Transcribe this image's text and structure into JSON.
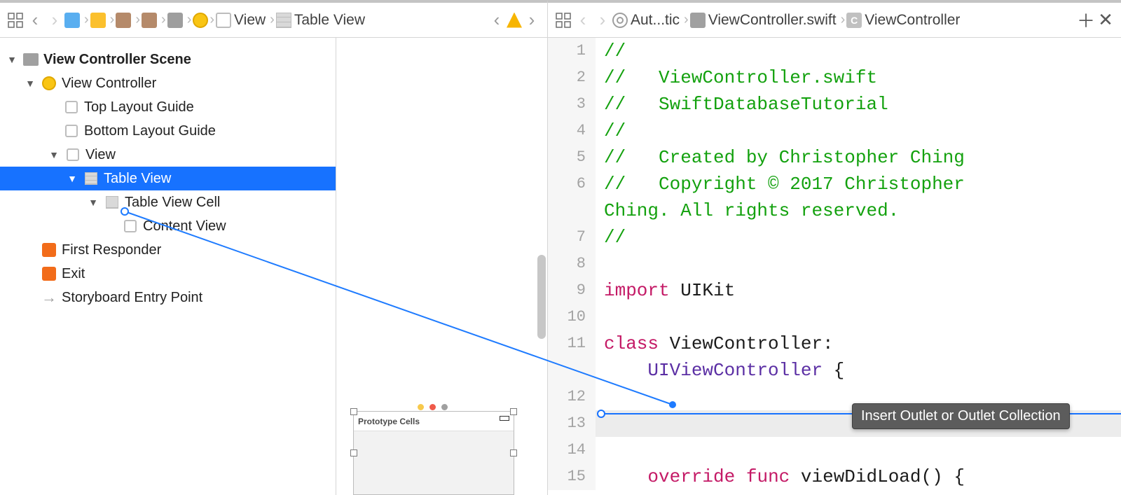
{
  "left_bar": {
    "crumb_view": "View",
    "crumb_tableview": "Table View"
  },
  "right_bar": {
    "crumb_aut": "Aut...tic",
    "crumb_file": "ViewController.swift",
    "crumb_class": "ViewController"
  },
  "outline": {
    "scene": "View Controller Scene",
    "vc": "View Controller",
    "top_guide": "Top Layout Guide",
    "bottom_guide": "Bottom Layout Guide",
    "view": "View",
    "table_view": "Table View",
    "table_view_cell": "Table View Cell",
    "content_view": "Content View",
    "first_responder": "First Responder",
    "exit": "Exit",
    "entry_point": "Storyboard Entry Point"
  },
  "canvas": {
    "prototype_label": "Prototype Cells"
  },
  "code": {
    "lines": [
      {
        "n": "1",
        "segs": [
          {
            "t": "//",
            "c": "c-comment"
          }
        ]
      },
      {
        "n": "2",
        "segs": [
          {
            "t": "//   ViewController.swift",
            "c": "c-comment"
          }
        ]
      },
      {
        "n": "3",
        "segs": [
          {
            "t": "//   SwiftDatabaseTutorial",
            "c": "c-comment"
          }
        ]
      },
      {
        "n": "4",
        "segs": [
          {
            "t": "//",
            "c": "c-comment"
          }
        ]
      },
      {
        "n": "5",
        "segs": [
          {
            "t": "//   Created by Christopher Ching",
            "c": "c-comment"
          }
        ]
      },
      {
        "n": "6",
        "segs": [
          {
            "t": "//   Copyright © 2017 Christopher Ching. All rights reserved.",
            "c": "c-comment"
          }
        ]
      },
      {
        "n": "7",
        "segs": [
          {
            "t": "//",
            "c": "c-comment"
          }
        ]
      },
      {
        "n": "8",
        "segs": [
          {
            "t": "",
            "c": "c-plain"
          }
        ]
      },
      {
        "n": "9",
        "segs": [
          {
            "t": "import",
            "c": "c-keyword"
          },
          {
            "t": " UIKit",
            "c": "c-plain"
          }
        ]
      },
      {
        "n": "10",
        "segs": [
          {
            "t": "",
            "c": "c-plain"
          }
        ]
      },
      {
        "n": "11",
        "segs": [
          {
            "t": "class",
            "c": "c-keyword"
          },
          {
            "t": " ViewController: ",
            "c": "c-plain"
          },
          {
            "t": "UIViewController",
            "c": "c-type"
          },
          {
            "t": " {",
            "c": "c-plain"
          }
        ]
      },
      {
        "n": "12",
        "segs": [
          {
            "t": "",
            "c": "c-plain"
          }
        ]
      },
      {
        "n": "13",
        "segs": [
          {
            "t": "",
            "c": "c-plain"
          }
        ],
        "current": true
      },
      {
        "n": "14",
        "segs": [
          {
            "t": "",
            "c": "c-plain"
          }
        ]
      },
      {
        "n": "15",
        "segs": [
          {
            "t": "    ",
            "c": "c-plain"
          },
          {
            "t": "override",
            "c": "c-keyword"
          },
          {
            "t": " ",
            "c": "c-plain"
          },
          {
            "t": "func",
            "c": "c-keyword"
          },
          {
            "t": " viewDidLoad() {",
            "c": "c-plain"
          }
        ]
      }
    ]
  },
  "tooltip": "Insert Outlet or Outlet Collection"
}
